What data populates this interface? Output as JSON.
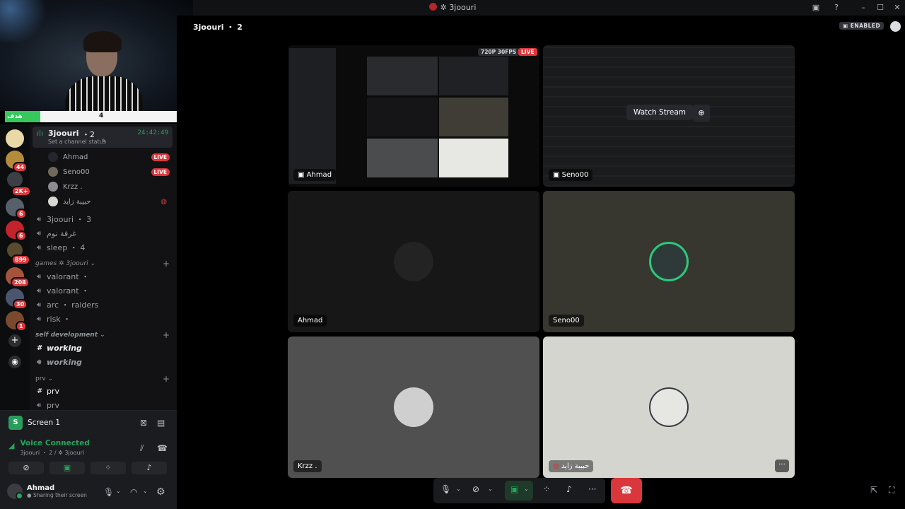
{
  "window": {
    "title": "3joouri"
  },
  "webcam": {
    "goal_label": "هدف مشترك",
    "goal_current": "4",
    "goal_max": "50"
  },
  "rail": {
    "badges": [
      "44",
      "2K+",
      "6",
      "6",
      "899",
      "208",
      "30",
      "1"
    ]
  },
  "sidebar": {
    "active_channel": {
      "name": "3joouri",
      "count": "2",
      "timer": "24:42:49",
      "status_placeholder": "Set a channel status"
    },
    "members": [
      {
        "name": "Ahmad",
        "live": "LIVE"
      },
      {
        "name": "Seno00",
        "live": "LIVE"
      },
      {
        "name": "Krzz ."
      },
      {
        "name": "حبيبة زايد"
      }
    ],
    "channels": [
      {
        "name": "3joouri",
        "count": "3"
      },
      {
        "name": "غرفة نوم"
      },
      {
        "name": "sleep",
        "count": "4"
      }
    ],
    "categories": [
      {
        "name": "games",
        "sub": "3joouri"
      },
      {
        "name": "self development"
      },
      {
        "name": "prv"
      }
    ],
    "games_channels": [
      "valorant",
      "valorant",
      "arc",
      "risk"
    ],
    "games_sub": [
      "",
      "",
      "raiders",
      ""
    ],
    "selfdev_channels": [
      "working",
      "working"
    ],
    "prv_channels": [
      "prv",
      "prv"
    ]
  },
  "user_panel": {
    "screen_share": "Screen 1",
    "voice_status": "Voice Connected",
    "voice_channel": "3joouri",
    "voice_count": "2",
    "voice_server": "3joouri",
    "username": "Ahmad",
    "user_status": "Sharing their screen"
  },
  "stage": {
    "header_title": "3joouri",
    "header_count": "2",
    "enabled_badge": "ENABLED",
    "tiles": [
      {
        "label": "Ahmad",
        "quality": "720P 30FPS",
        "live": "LIVE"
      },
      {
        "label": "Seno00",
        "watch": "Watch Stream"
      },
      {
        "label": "Ahmad"
      },
      {
        "label": "Seno00"
      },
      {
        "label": "Krzz ."
      },
      {
        "label": "حبيبة زايد"
      }
    ]
  },
  "icons": [
    "mic-icon",
    "camera-off-icon",
    "screen-share-icon",
    "activities-icon",
    "soundboard-icon",
    "more-icon",
    "hangup-icon",
    "settings-icon",
    "headphones-icon",
    "popout-icon",
    "fullscreen-icon"
  ],
  "colors": {
    "accent_green": "#23a55a",
    "danger_red": "#da373c",
    "live_red": "#da373c"
  }
}
